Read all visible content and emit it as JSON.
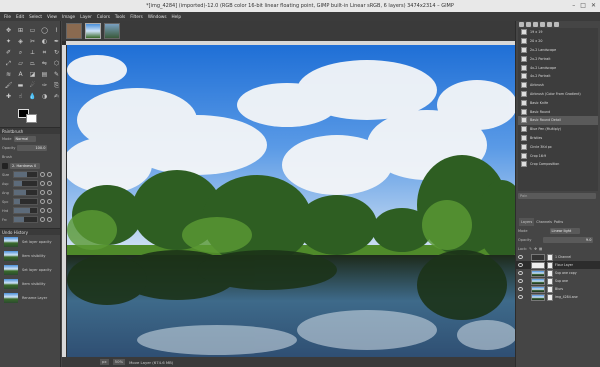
{
  "window_title": "*[img_4284] (imported)-12.0 (RGB color 16-bit linear floating point, GIMP built-in Linear sRGB, 6 layers) 3474x2314 – GIMP",
  "window_buttons": [
    "–",
    "□",
    "✕"
  ],
  "menu": [
    "File",
    "Edit",
    "Select",
    "View",
    "Image",
    "Layer",
    "Colors",
    "Tools",
    "Filters",
    "Windows",
    "Help"
  ],
  "toolbox": {
    "paintbrush_title": "Paintbrush",
    "mode_label": "Mode",
    "mode_value": "Normal",
    "opacity_label": "Opacity",
    "opacity_value": "100.0",
    "brush_label": "Brush",
    "brush_value": "2. Hardness 0",
    "opacity_fill": 0.95,
    "sliders": [
      {
        "label": "Size",
        "fill": 0.55
      },
      {
        "label": "Asp",
        "fill": 0.35
      },
      {
        "label": "Ang",
        "fill": 0.5
      },
      {
        "label": "Spc",
        "fill": 0.25
      },
      {
        "label": "Hrd",
        "fill": 0.7
      },
      {
        "label": "Frc",
        "fill": 0.45
      }
    ],
    "undo_title": "Undo History",
    "undo_items": [
      "Set layer opacity",
      "Item visibility",
      "Set layer opacity",
      "Item visibility",
      "Rename Layer"
    ]
  },
  "status": {
    "unit": "px",
    "zoom": "50%",
    "message": "Move Layer (674.6 MB)"
  },
  "brushes": {
    "items": [
      "19 x 19",
      "20 x 20",
      "2x-2 Landscape",
      "2x-2 Portrait",
      "4x-2 Landscape",
      "4x-2 Portrait",
      "Airbrush",
      "Airbrush (Color From Gradient)",
      "Basic Knife",
      "Basic Round",
      "Basic Round Detail",
      "Blue Pen (Multiply)",
      "Bristles",
      "Circle 3Kd px",
      "Crop 16:9",
      "Crop Composition"
    ],
    "selected_index": 10,
    "filter_placeholder": "Pain"
  },
  "layers_panel": {
    "tabs": [
      "Layers",
      "Channels",
      "Paths"
    ],
    "mode_label": "Mode",
    "mode_value": "Linear light",
    "opacity_label": "Opacity",
    "opacity_value": "9.0",
    "lock_label": "Lock:",
    "layers": [
      {
        "name": "1 Channel",
        "thumb": "dark"
      },
      {
        "name": "Flour Layer",
        "thumb": "white",
        "selected": true
      },
      {
        "name": "Sup one copy",
        "thumb": "photo"
      },
      {
        "name": "Sup one",
        "thumb": "photo"
      },
      {
        "name": "Blurs",
        "thumb": "photo"
      },
      {
        "name": "img_4284.arw",
        "thumb": "photo"
      }
    ]
  }
}
